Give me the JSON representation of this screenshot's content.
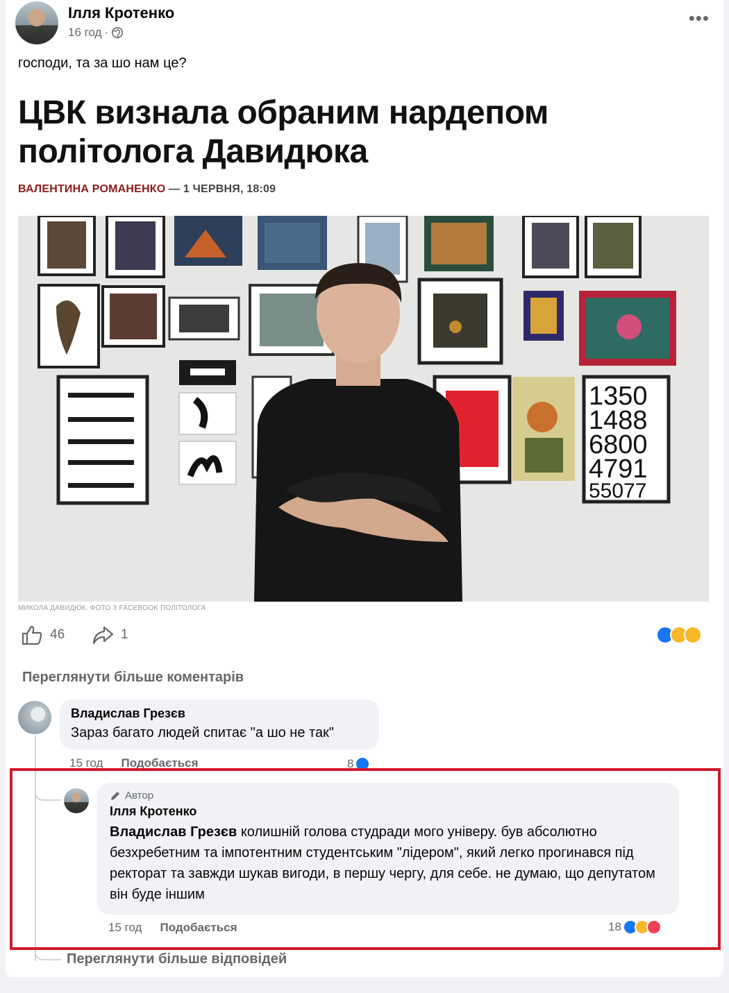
{
  "post": {
    "author": "Ілля Кротенко",
    "time": "16 год",
    "separator": "·",
    "text": "господи, та за шо нам це?"
  },
  "article": {
    "headline": "ЦВК визнала обраним нардепом політолога Давидюка",
    "byline_author": "ВАЛЕНТИНА РОМАНЕНКО",
    "byline_rest": " — 1 ЧЕРВНЯ, 18:09",
    "photo_caption": "МИКОЛА ДАВИДЮК. ФОТО З FACEBOOK ПОЛІТОЛОГА",
    "artwork_numbers": [
      "1350",
      "1488",
      "6800",
      "4791",
      "55077"
    ]
  },
  "engagement": {
    "likes": "46",
    "shares": "1",
    "reactions": [
      "like-icon",
      "haha-icon",
      "wow-icon"
    ]
  },
  "comments": {
    "view_more": "Переглянути більше коментарів",
    "first": {
      "name": "Владислав Грезєв",
      "text": "Зараз багато людей спитає \"а шо не так\"",
      "time": "15 год",
      "like_label": "Подобається",
      "count": "8"
    },
    "reply": {
      "badge": "Автор",
      "name": "Ілля Кротенко",
      "mention": "Владислав Грезєв",
      "text": " колишній голова студради мого універу. був абсолютно безхребетним та імпотентним студентським \"лідером\", який легко прогинався під ректорат та завжди шукав вигоди, в першу чергу, для себе. не думаю, що депутатом він буде іншим",
      "time": "15 год",
      "like_label": "Подобається",
      "count": "18"
    },
    "view_more_replies": "Переглянути більше відповідей"
  },
  "colors": {
    "highlight": "#d11a2a",
    "byline_author": "#8b1a1a",
    "facebook_blue": "#1877f2"
  }
}
